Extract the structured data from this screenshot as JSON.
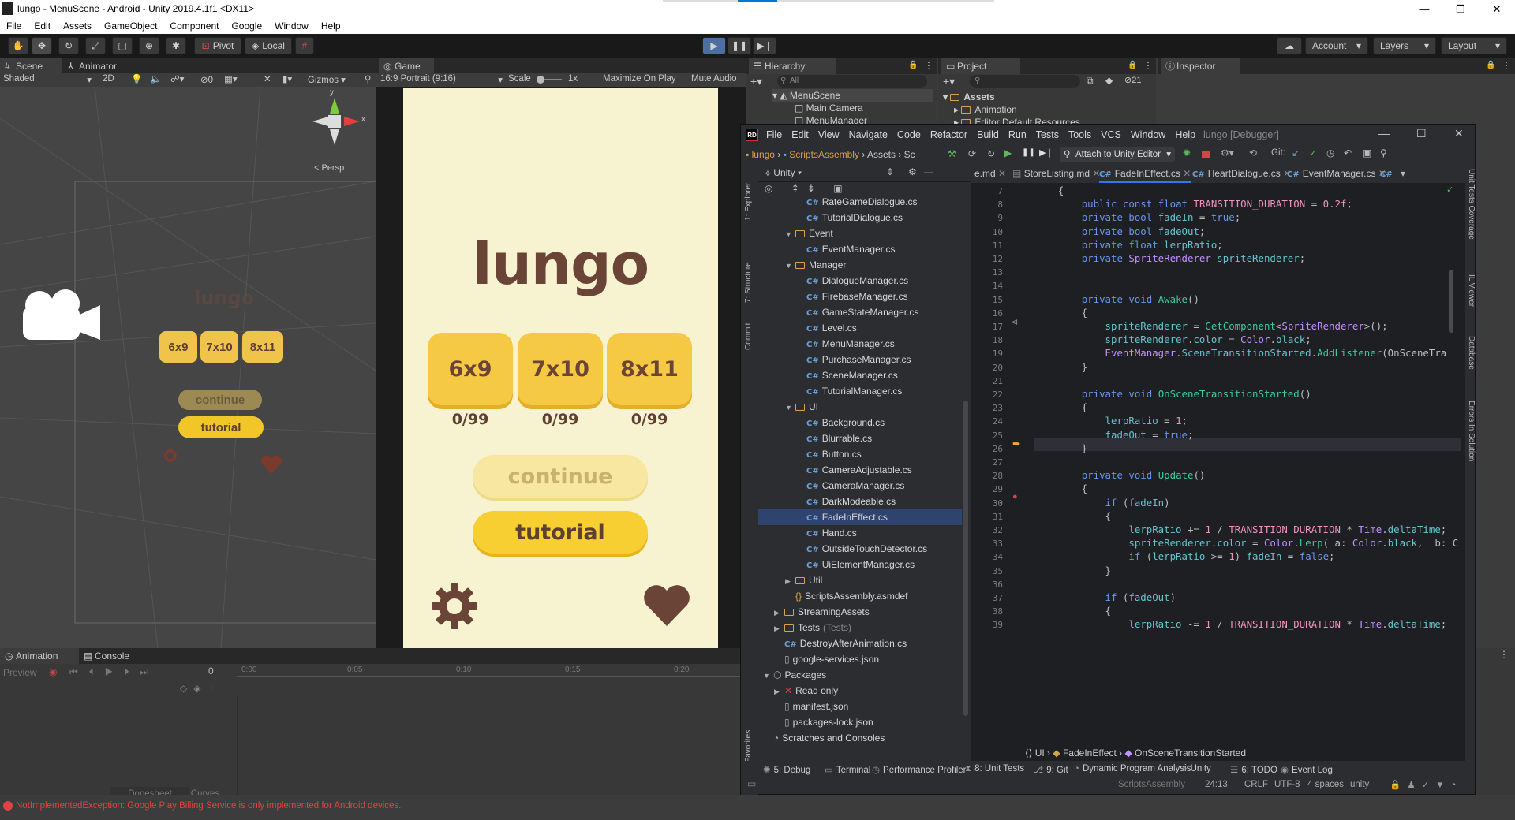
{
  "window": {
    "title": "lungo - MenuScene - Android - Unity 2019.4.1f1 <DX11>",
    "minimize": "—",
    "maximize": "❐",
    "close": "✕"
  },
  "menu": [
    "File",
    "Edit",
    "Assets",
    "GameObject",
    "Component",
    "Google",
    "Window",
    "Help"
  ],
  "toolbar": {
    "pivot": "Pivot",
    "local": "Local",
    "account": "Account",
    "layers": "Layers",
    "layout": "Layout"
  },
  "scene": {
    "tab_scene": "Scene",
    "tab_animator": "Animator",
    "shading": "Shaded",
    "mode2d": "2D",
    "fx_count": "0",
    "gizmos": "Gizmos",
    "persp": "< Persp",
    "axis_y": "y",
    "axis_x": "x",
    "mini_title": "lungo",
    "mini_tiles": [
      "6x9",
      "7x10",
      "8x11"
    ],
    "mini_continue": "continue",
    "mini_tutorial": "tutorial"
  },
  "game": {
    "tab": "Game",
    "aspect": "16:9 Portrait (9:16)",
    "scale_label": "Scale",
    "scale_value": "1x",
    "maximize": "Maximize On Play",
    "mute": "Mute Audio",
    "title": "lungo",
    "levels": [
      {
        "name": "6x9",
        "score": "0/99"
      },
      {
        "name": "7x10",
        "score": "0/99"
      },
      {
        "name": "8x11",
        "score": "0/99"
      }
    ],
    "continue": "continue",
    "tutorial": "tutorial",
    "colors": {
      "bg": "#f7f2cf",
      "tile": "#f6c944",
      "text": "#6a4436",
      "continue_bg": "#f7e7a1"
    }
  },
  "hierarchy": {
    "tab": "Hierarchy",
    "search": "All",
    "items": [
      "MenuScene",
      "Main Camera",
      "MenuManager"
    ]
  },
  "project": {
    "tab": "Project",
    "badge": "21",
    "items": [
      "Assets",
      "Animation",
      "Editor Default Resources"
    ]
  },
  "inspector": {
    "tab": "Inspector"
  },
  "rider": {
    "menu": [
      "File",
      "Edit",
      "View",
      "Navigate",
      "Code",
      "Refactor",
      "Build",
      "Run",
      "Tests",
      "Tools",
      "VCS",
      "Window",
      "Help"
    ],
    "window_title": "lungo [Debugger]",
    "breadcrumb": [
      "lungo",
      "ScriptsAssembly",
      "Assets",
      "Sc"
    ],
    "attach": "Attach to Unity Editor",
    "git": "Git:",
    "explorer_root": "Unity",
    "side_tabs": [
      "1: Explorer",
      "7: Structure",
      "Commit",
      "2: Favorites"
    ],
    "right_tabs": [
      "Unit Tests Coverage",
      "IL Viewer",
      "Database",
      "Errors In Solution"
    ],
    "tree": [
      {
        "indent": 3,
        "type": "cs",
        "label": "RateGameDialogue.cs"
      },
      {
        "indent": 3,
        "type": "cs",
        "label": "TutorialDialogue.cs"
      },
      {
        "indent": 2,
        "type": "folder",
        "label": "Event",
        "open": true
      },
      {
        "indent": 3,
        "type": "cs",
        "label": "EventManager.cs"
      },
      {
        "indent": 2,
        "type": "folder",
        "label": "Manager",
        "open": true
      },
      {
        "indent": 3,
        "type": "cs",
        "label": "DialogueManager.cs"
      },
      {
        "indent": 3,
        "type": "cs",
        "label": "FirebaseManager.cs"
      },
      {
        "indent": 3,
        "type": "cs",
        "label": "GameStateManager.cs"
      },
      {
        "indent": 3,
        "type": "cs",
        "label": "Level.cs"
      },
      {
        "indent": 3,
        "type": "cs",
        "label": "MenuManager.cs"
      },
      {
        "indent": 3,
        "type": "cs",
        "label": "PurchaseManager.cs"
      },
      {
        "indent": 3,
        "type": "cs",
        "label": "SceneManager.cs"
      },
      {
        "indent": 3,
        "type": "cs",
        "label": "TutorialManager.cs"
      },
      {
        "indent": 2,
        "type": "folder",
        "label": "UI",
        "open": true
      },
      {
        "indent": 3,
        "type": "cs",
        "label": "Background.cs"
      },
      {
        "indent": 3,
        "type": "cs",
        "label": "Blurrable.cs"
      },
      {
        "indent": 3,
        "type": "cs",
        "label": "Button.cs"
      },
      {
        "indent": 3,
        "type": "cs",
        "label": "CameraAdjustable.cs"
      },
      {
        "indent": 3,
        "type": "cs",
        "label": "CameraManager.cs"
      },
      {
        "indent": 3,
        "type": "cs",
        "label": "DarkModeable.cs"
      },
      {
        "indent": 3,
        "type": "cs",
        "label": "FadeInEffect.cs",
        "selected": true
      },
      {
        "indent": 3,
        "type": "cs",
        "label": "Hand.cs"
      },
      {
        "indent": 3,
        "type": "cs",
        "label": "OutsideTouchDetector.cs"
      },
      {
        "indent": 3,
        "type": "cs",
        "label": "UiElementManager.cs"
      },
      {
        "indent": 2,
        "type": "folder",
        "label": "Util",
        "open": false
      },
      {
        "indent": 2,
        "type": "asmdef",
        "label": "ScriptsAssembly.asmdef"
      },
      {
        "indent": 1,
        "type": "folder",
        "label": "StreamingAssets",
        "open": false
      },
      {
        "indent": 1,
        "type": "folder",
        "label": "Tests",
        "suffix": "(Tests)",
        "open": false
      },
      {
        "indent": 1,
        "type": "cs",
        "label": "DestroyAfterAnimation.cs"
      },
      {
        "indent": 1,
        "type": "file",
        "label": "google-services.json"
      },
      {
        "indent": 0,
        "type": "pkg",
        "label": "Packages",
        "open": true
      },
      {
        "indent": 1,
        "type": "lib",
        "label": "Read only",
        "open": false
      },
      {
        "indent": 1,
        "type": "file",
        "label": "manifest.json"
      },
      {
        "indent": 1,
        "type": "file",
        "label": "packages-lock.json"
      },
      {
        "indent": 0,
        "type": "scratch",
        "label": "Scratches and Consoles"
      }
    ],
    "tabs": [
      {
        "label": "e.md"
      },
      {
        "label": "StoreListing.md"
      },
      {
        "label": "FadeInEffect.cs",
        "active": true
      },
      {
        "label": "HeartDialogue.cs"
      },
      {
        "label": "EventManager.cs"
      },
      {
        "label": "C#"
      }
    ],
    "line_numbers": [
      7,
      8,
      9,
      10,
      11,
      12,
      13,
      14,
      15,
      16,
      17,
      18,
      19,
      20,
      21,
      22,
      23,
      24,
      25,
      26,
      27,
      28,
      29,
      30,
      31,
      32,
      33,
      34,
      35,
      36,
      37,
      38,
      39
    ],
    "code_lines": [
      "    {",
      "        public const float TRANSITION_DURATION = 0.2f;",
      "        private bool fadeIn = true;",
      "        private bool fadeOut;",
      "        private float lerpRatio;",
      "        private SpriteRenderer spriteRenderer;",
      "",
      "",
      "        private void Awake()",
      "        {",
      "            spriteRenderer = GetComponent<SpriteRenderer>();",
      "            spriteRenderer.color = Color.black;",
      "            EventManager.SceneTransitionStarted.AddListener(OnSceneTra",
      "        }",
      "",
      "        private void OnSceneTransitionStarted()",
      "        {",
      "            lerpRatio = 1;",
      "            fadeOut = true;",
      "        }",
      "",
      "        private void Update()",
      "        {",
      "            if (fadeIn)",
      "            {",
      "                lerpRatio += 1 / TRANSITION_DURATION * Time.deltaTime;",
      "                spriteRenderer.color = Color.Lerp( a: Color.black,  b: C",
      "                if (lerpRatio >= 1) fadeIn = false;",
      "            }",
      "",
      "            if (fadeOut)",
      "            {",
      "                lerpRatio -= 1 / TRANSITION_DURATION * Time.deltaTime;"
    ],
    "nav_crumbs": [
      "UI",
      "FadeInEffect",
      "OnSceneTransitionStarted"
    ],
    "bottom_tabs": [
      "5: Debug",
      "Terminal",
      "Performance Profiler",
      "8: Unit Tests",
      "9: Git",
      "Dynamic Program Analysis",
      "Unity",
      "6: TODO",
      "Event Log"
    ],
    "status": [
      "ScriptsAssembly",
      "24:13",
      "CRLF",
      "UTF-8",
      "4 spaces",
      "unity"
    ]
  },
  "animation": {
    "tab_animation": "Animation",
    "tab_console": "Console",
    "preview": "Preview",
    "frame": "0",
    "ticks": [
      "0:00",
      "0:05",
      "0:10",
      "0:15",
      "0:20"
    ],
    "dopesheet": "Dopesheet",
    "curves": "Curves"
  },
  "status_error": "NotImplementedException: Google Play Billing Service is only implemented for Android devices."
}
